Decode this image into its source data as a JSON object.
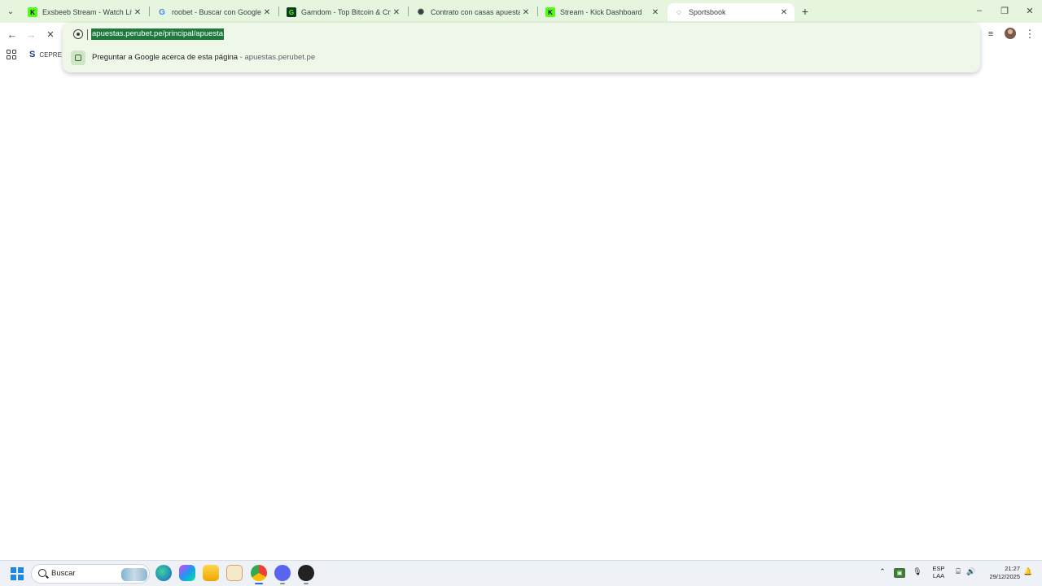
{
  "browser": {
    "tabs": [
      {
        "title": "Exsbeeb Stream - Watch Live o",
        "favicon": "kick-icon",
        "active": false
      },
      {
        "title": "roobet - Buscar con Google",
        "favicon": "google-icon",
        "active": false
      },
      {
        "title": "Gamdom - Top Bitcoin & Crypt",
        "favicon": "gamdom-icon",
        "active": false
      },
      {
        "title": "Contrato con casas apuestas",
        "favicon": "chatgpt-icon",
        "active": false
      },
      {
        "title": "Stream - Kick Dashboard",
        "favicon": "kick-icon",
        "active": false
      },
      {
        "title": "Sportsbook",
        "favicon": "loading-icon",
        "active": true
      }
    ],
    "newtab_label": "+",
    "window_controls": {
      "minimize": "–",
      "restore": "❐",
      "close": "✕"
    }
  },
  "omnibox": {
    "url": "apuestas.perubet.pe/principal/apuesta",
    "suggestion_text": "Preguntar a Google acerca de esta página",
    "suggestion_separator": " - ",
    "suggestion_url": "apuestas.perubet.pe"
  },
  "bookmarks": {
    "item1": "CEPRE"
  },
  "taskbar": {
    "search_placeholder": "Buscar",
    "lang_line1": "ESP",
    "lang_line2": "LAA",
    "time": "21:27",
    "date": "29/12/2025"
  },
  "colors": {
    "tabstrip_bg": "#e6f5de",
    "url_selection": "#1e7a3c",
    "omnibox_bg": "#eef7e8",
    "kick_green": "#53fc18"
  }
}
